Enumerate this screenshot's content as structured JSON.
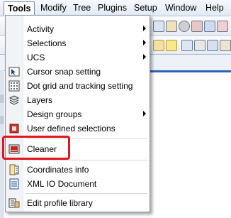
{
  "menubar": {
    "items": [
      "Tools",
      "Modify",
      "Tree",
      "Plugins",
      "Setup",
      "Window",
      "Help"
    ],
    "active": "Tools"
  },
  "tools_menu": {
    "items": [
      {
        "label": "Activity",
        "icon": "none",
        "submenu": true
      },
      {
        "label": "Selections",
        "icon": "none",
        "submenu": true
      },
      {
        "label": "UCS",
        "icon": "none",
        "submenu": true
      },
      {
        "label": "Cursor snap setting",
        "icon": "cursor-snap-icon",
        "submenu": false
      },
      {
        "label": "Dot grid and tracking setting",
        "icon": "dot-grid-icon",
        "submenu": false
      },
      {
        "label": "Layers",
        "icon": "layers-icon",
        "submenu": false
      },
      {
        "label": "Design groups",
        "icon": "none",
        "submenu": true
      },
      {
        "label": "User defined selections",
        "icon": "user-selections-icon",
        "submenu": false
      },
      {
        "label": "Cleaner",
        "icon": "cleaner-icon",
        "submenu": false
      },
      {
        "label": "Coordinates info",
        "icon": "coordinates-info-icon",
        "submenu": false
      },
      {
        "label": "XML IO Document",
        "icon": "xml-document-icon",
        "submenu": false
      },
      {
        "label": "Edit profile library",
        "icon": "profile-library-icon",
        "submenu": false
      }
    ],
    "highlighted_item": "Cleaner"
  },
  "colors": {
    "highlight_outline": "#e3141b",
    "accent_blue": "#2f63b8"
  }
}
